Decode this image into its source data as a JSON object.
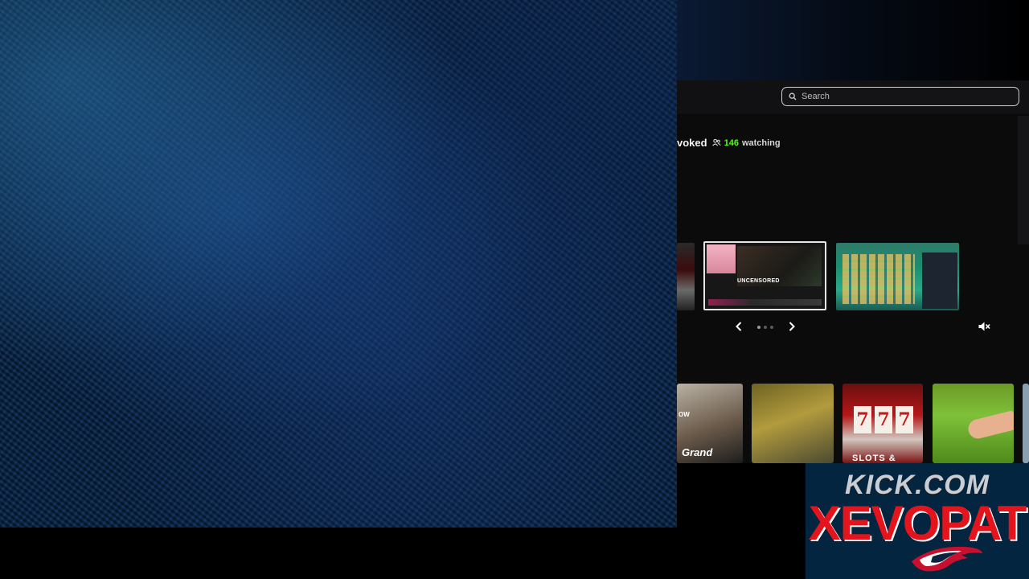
{
  "search": {
    "placeholder": "Search"
  },
  "stream": {
    "title_fragment": "voked",
    "viewer_count": "146",
    "viewer_label": "watching"
  },
  "carousel": {
    "featured_caption": "UNCENSORED",
    "total_dots": 3,
    "active_dot": 1
  },
  "categories": [
    {
      "label": "Grand",
      "tag": "OW"
    },
    {
      "label": ""
    },
    {
      "label": "SLOTS &"
    },
    {
      "label": ""
    }
  ],
  "overlay": {
    "line1": "KICK.COM",
    "line2": "XEVOPAT"
  },
  "colors": {
    "accent_green": "#53fc18",
    "brand_red": "#e3141c",
    "brand_navy": "#03253f"
  }
}
